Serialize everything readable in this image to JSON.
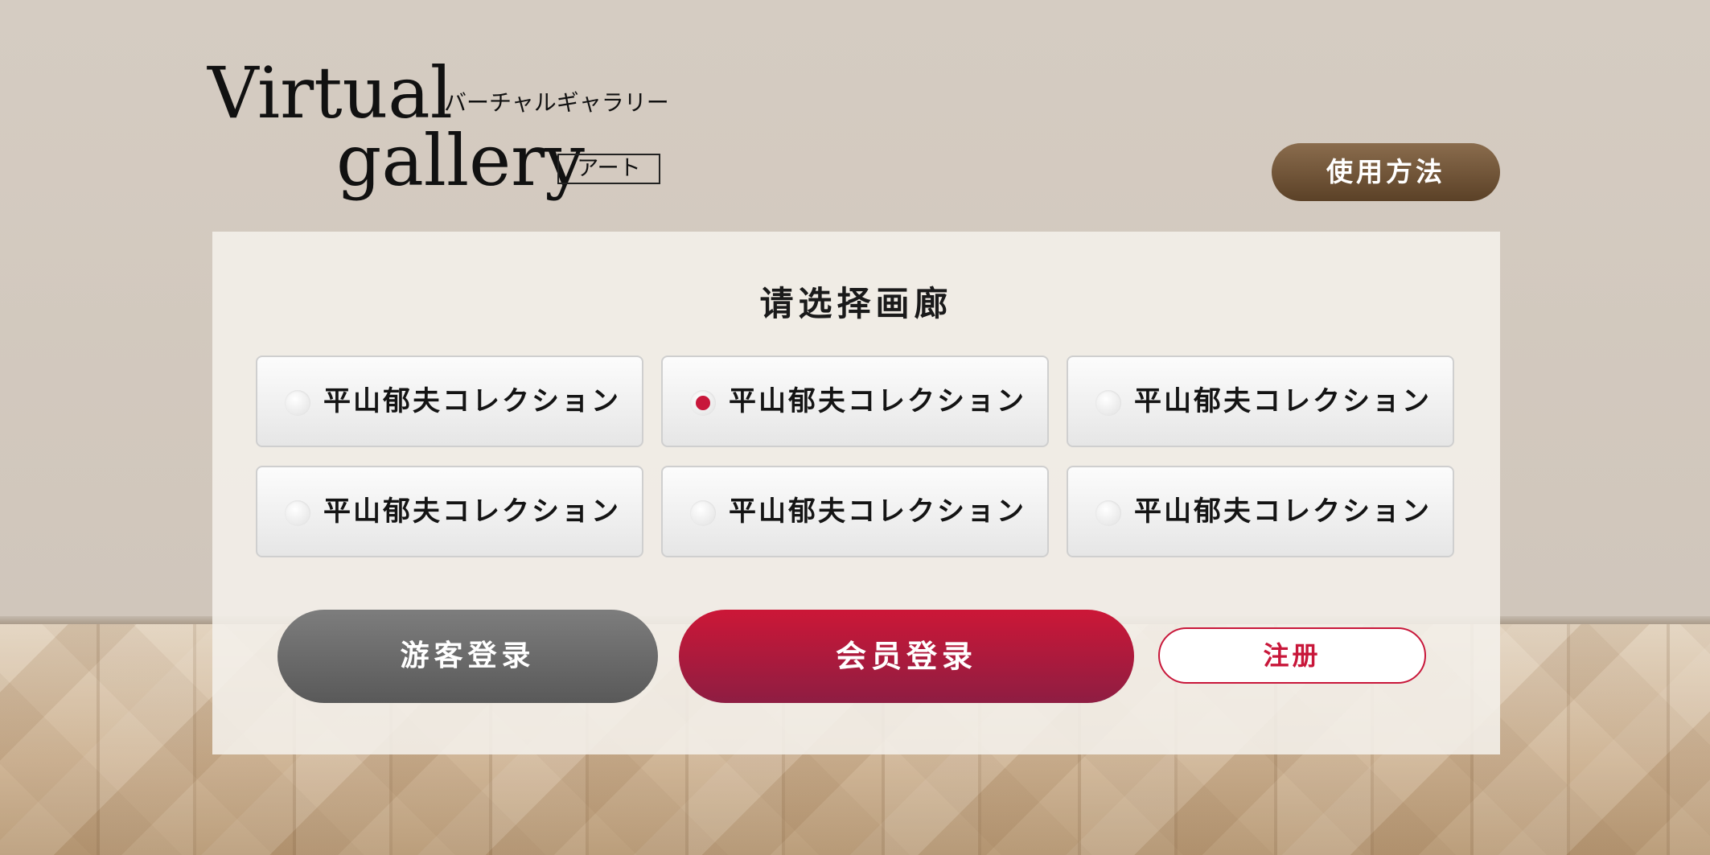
{
  "logo": {
    "line1": "Virtual",
    "kana": "バーチャルギャラリー",
    "line2": "gallery",
    "badge": "アート"
  },
  "header": {
    "howto_label": "使用方法"
  },
  "panel": {
    "title": "请选择画廊",
    "selected_index": 1,
    "options": [
      {
        "label": "平山郁夫コレクション",
        "checked": false
      },
      {
        "label": "平山郁夫コレクション",
        "checked": true
      },
      {
        "label": "平山郁夫コレクション",
        "checked": false
      },
      {
        "label": "平山郁夫コレクション",
        "checked": false
      },
      {
        "label": "平山郁夫コレクション",
        "checked": false
      },
      {
        "label": "平山郁夫コレクション",
        "checked": false
      }
    ]
  },
  "actions": {
    "guest_label": "游客登录",
    "member_label": "会员登录",
    "register_label": "注册"
  },
  "colors": {
    "accent": "#c8173a",
    "howto": "#6e5336",
    "guest": "#6a6a6a"
  }
}
